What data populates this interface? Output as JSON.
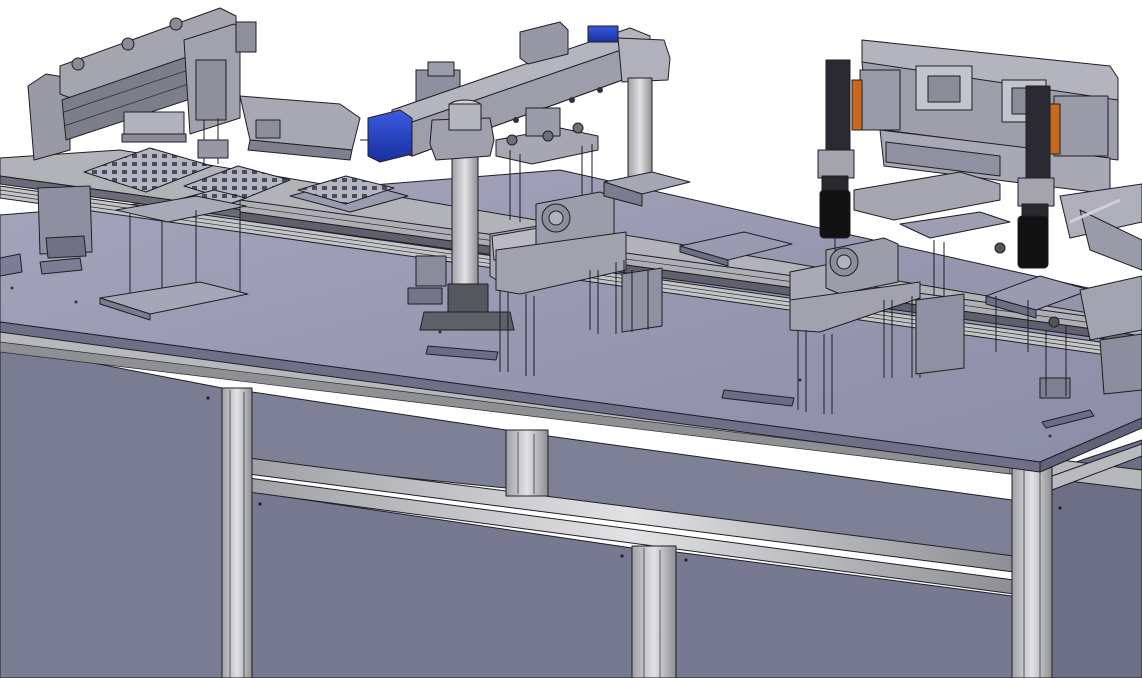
{
  "scene": {
    "subject": "cad-assembly-automated-conveyor-workstation",
    "background_color": "#ffffff",
    "palette": {
      "table_top": "#8f90a8",
      "table_top_light": "#a3a4ba",
      "cabinet_panel": "#787a90",
      "aluminium_profile": "#a9aaad",
      "machined_part": "#9e9fa8",
      "cylinder_black": "#121212",
      "motor_blue": "#1f3fc6",
      "accent_orange": "#c8691e",
      "edge_lines": "#1e1e24"
    }
  }
}
